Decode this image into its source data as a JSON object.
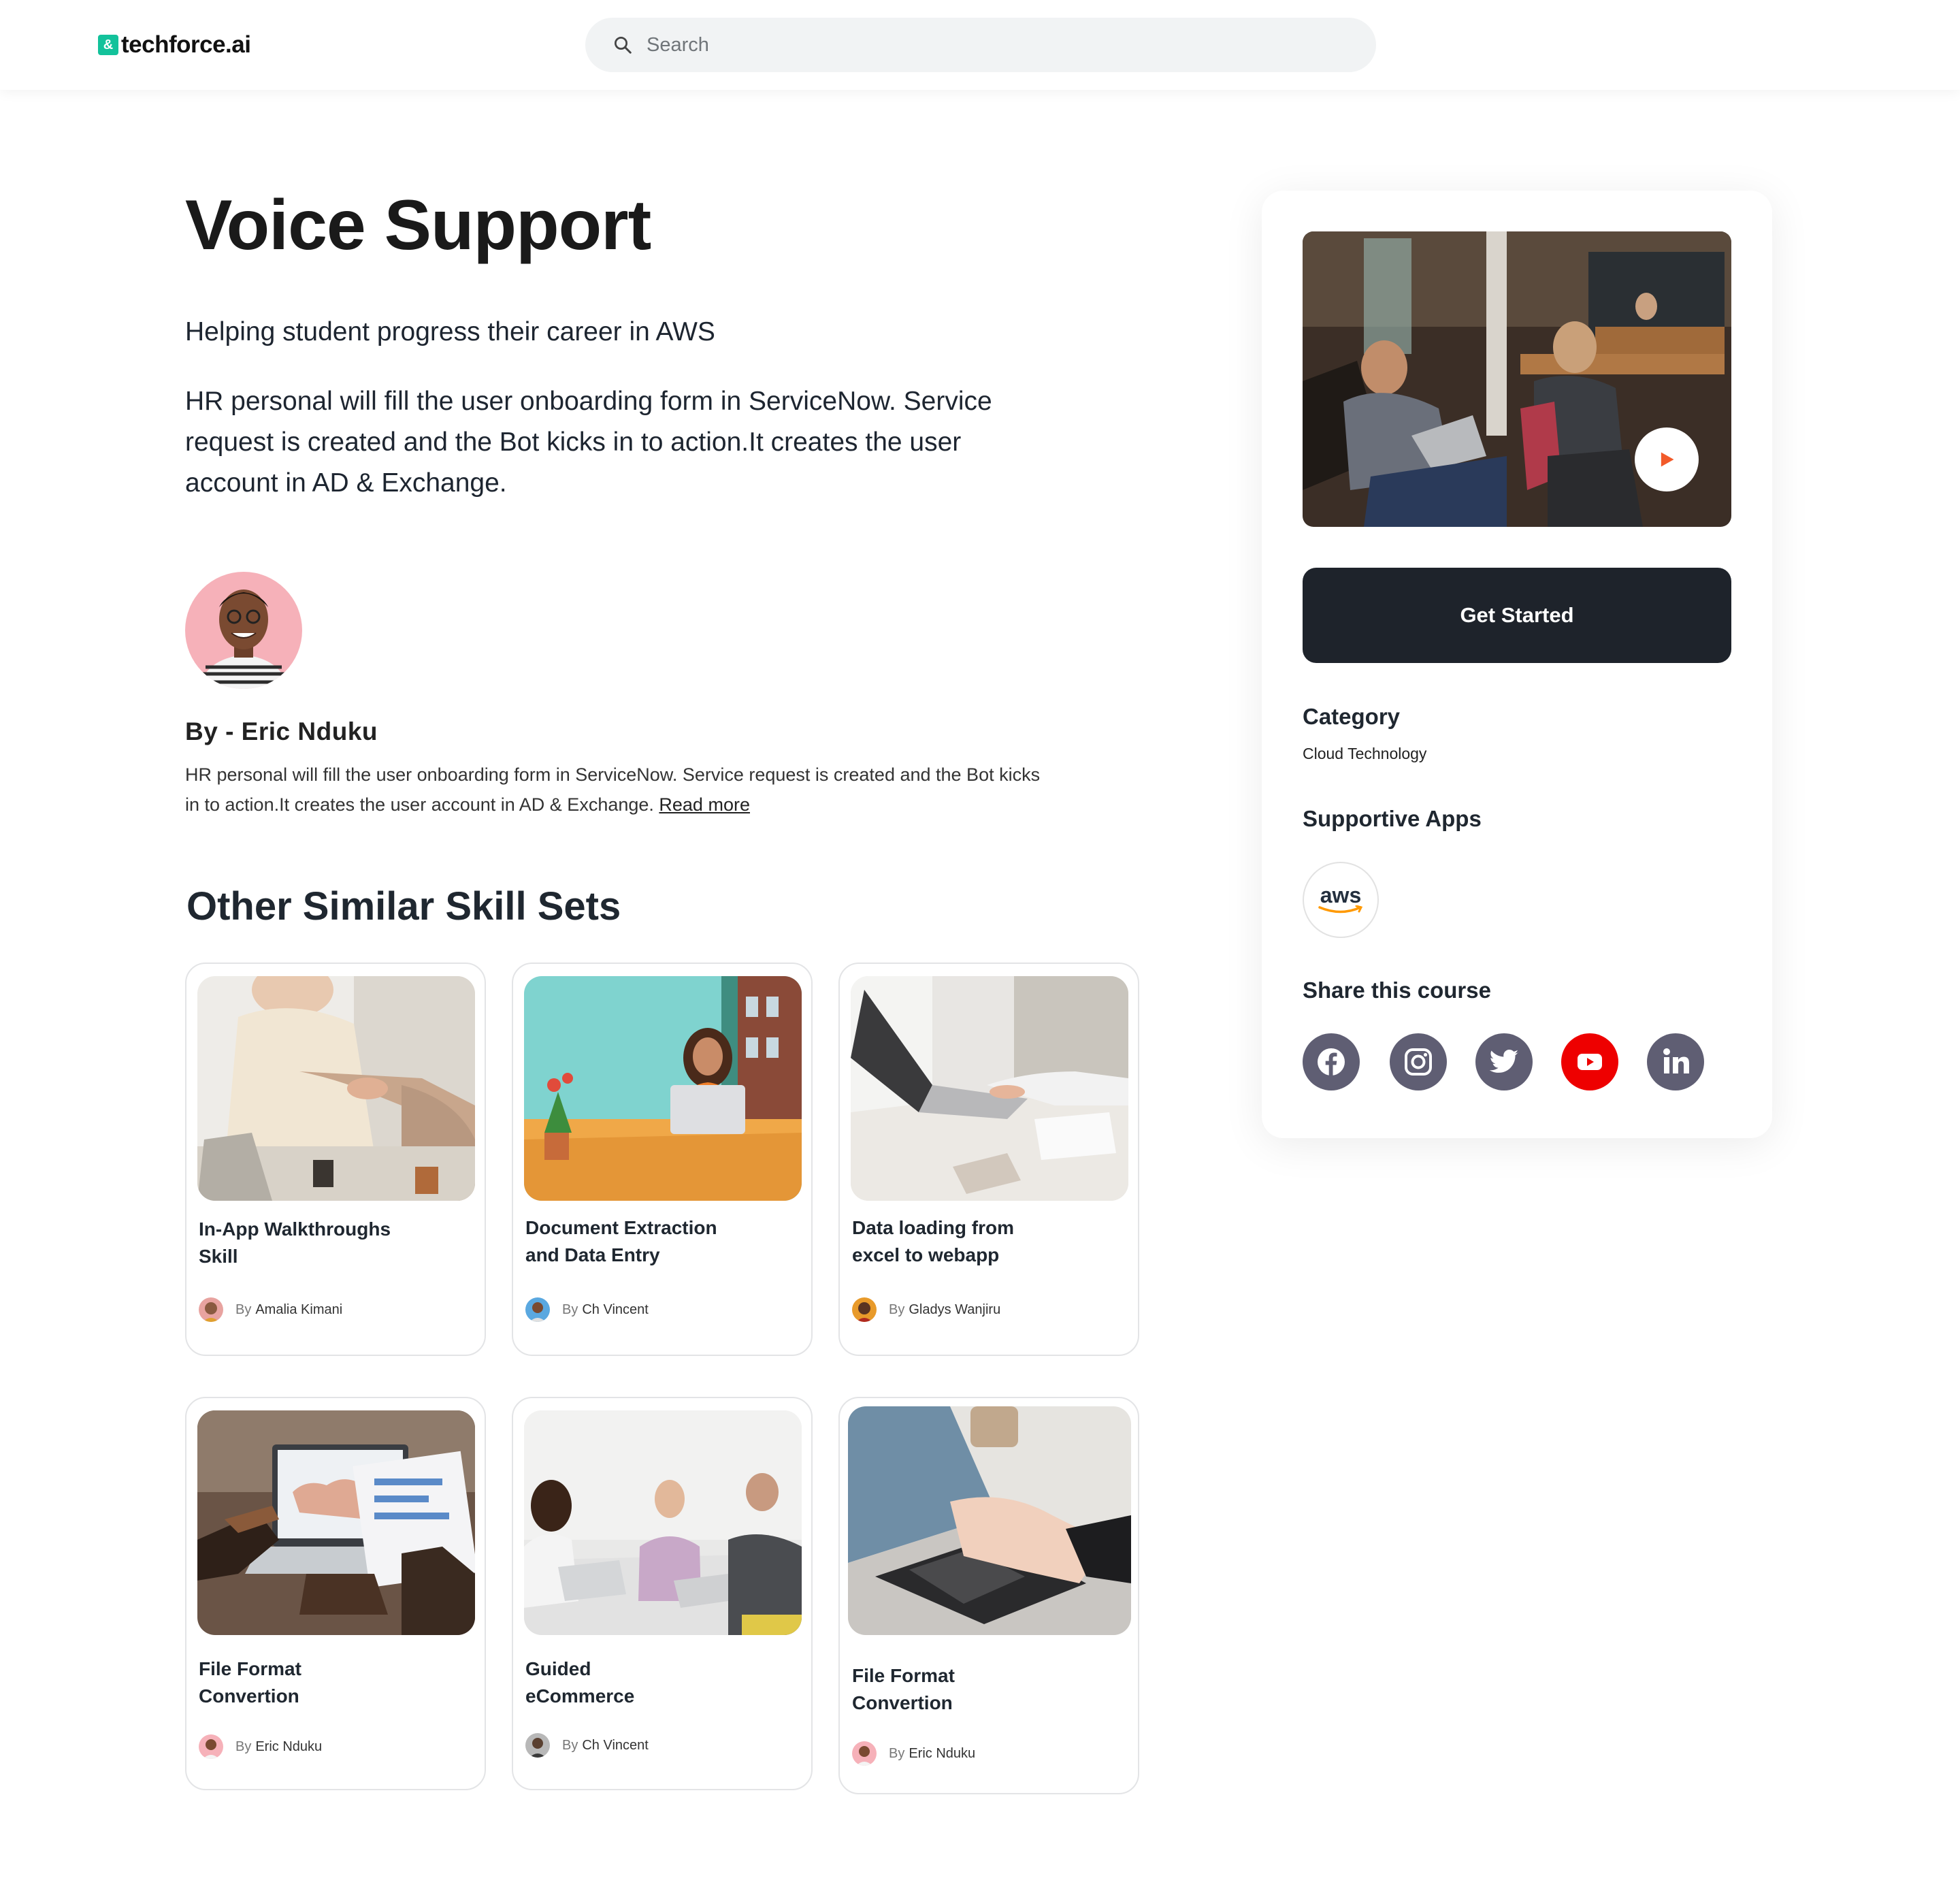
{
  "header": {
    "logo_mark": "&",
    "logo_text": "techforce.ai",
    "search_placeholder": "Search"
  },
  "course": {
    "title": "Voice Support",
    "subtitle": "Helping student progress their career in AWS",
    "description": "HR personal will fill the user onboarding form in ServiceNow. Service request is created and the Bot kicks in to action.It creates the user account in AD & Exchange."
  },
  "author": {
    "name": "By - Eric Nduku",
    "bio": "HR personal will fill the user onboarding form in ServiceNow. Service request is created and the Bot kicks in to action.It creates the user account in AD & Exchange. ",
    "read_more": "Read more"
  },
  "similar": {
    "heading": "Other Similar Skill Sets",
    "by_label": "By",
    "cards": [
      {
        "title_1": "In-App Walkthroughs",
        "title_2": "Skill",
        "author": "Amalia Kimani"
      },
      {
        "title_1": "Document Extraction",
        "title_2": "and Data Entry",
        "author": "Ch Vincent"
      },
      {
        "title_1": "Data loading from",
        "title_2": "excel to webapp",
        "author": "Gladys Wanjiru"
      },
      {
        "title_1": "File Format",
        "title_2": "Convertion",
        "author": "Eric Nduku"
      },
      {
        "title_1": "Guided",
        "title_2": "eCommerce",
        "author": "Ch Vincent"
      },
      {
        "title_1": "File Format",
        "title_2": "Convertion",
        "author": "Eric Nduku"
      }
    ]
  },
  "sidebar": {
    "cta_label": "Get Started",
    "category_label": "Category",
    "category_value": "Cloud Technology",
    "apps_label": "Supportive Apps",
    "app_logo_text": "aws",
    "share_label": "Share this course",
    "social_icons": [
      "facebook-icon",
      "instagram-icon",
      "twitter-icon",
      "youtube-icon",
      "linkedin-icon"
    ]
  },
  "colors": {
    "brand_green": "#13c29b",
    "cta_dark": "#1e232b",
    "play_orange": "#f25a2a",
    "social_gray": "#5f5e73",
    "youtube_red": "#ee0000",
    "aws_orange": "#ff9900"
  }
}
